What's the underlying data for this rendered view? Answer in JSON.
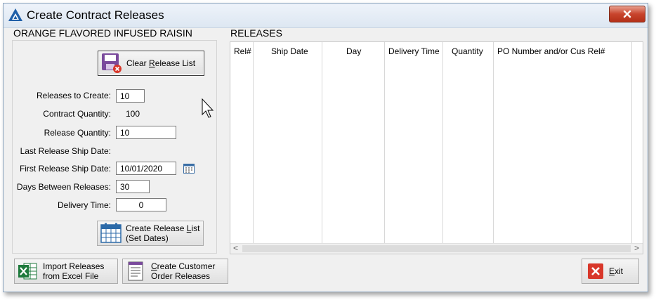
{
  "window": {
    "title": "Create Contract Releases",
    "close_icon": "close-icon"
  },
  "product_name": "ORANGE FLAVORED INFUSED RAISIN",
  "releases_title": "RELEASES",
  "clear_button": {
    "label_pre": "Clear ",
    "label_accel": "R",
    "label_post": "elease List"
  },
  "fields": {
    "releases_to_create_label": "Releases to Create:",
    "releases_to_create_value": "10",
    "contract_quantity_label": "Contract Quantity:",
    "contract_quantity_value": "100",
    "release_quantity_label": "Release Quantity:",
    "release_quantity_value": "10",
    "last_release_ship_date_label": "Last Release Ship Date:",
    "first_release_ship_date_label": "First Release Ship Date:",
    "first_release_ship_date_value": "10/01/2020",
    "days_between_label": "Days Between Releases:",
    "days_between_value": "30",
    "delivery_time_label": "Delivery Time:",
    "delivery_time_value": "0"
  },
  "create_button": {
    "line1_pre": "Create Release ",
    "line1_accel": "L",
    "line1_post": "ist",
    "line2": "(Set Dates)"
  },
  "table": {
    "columns": [
      "Rel#",
      "Ship Date",
      "Day",
      "Delivery Time",
      "Quantity",
      "PO Number and/or Cus Rel#"
    ],
    "scroll_left": "<",
    "scroll_right": ">"
  },
  "import_button": {
    "line1": "Import Releases",
    "line2": "from Excel File"
  },
  "customer_button": {
    "line1_accel": "C",
    "line1_post": "reate Customer",
    "line2": "Order Releases"
  },
  "exit_button": {
    "label_accel": "E",
    "label_post": "xit"
  },
  "colors": {
    "accent": "#7a4a9c",
    "close": "#c8442d",
    "excel": "#1e7a3c"
  }
}
